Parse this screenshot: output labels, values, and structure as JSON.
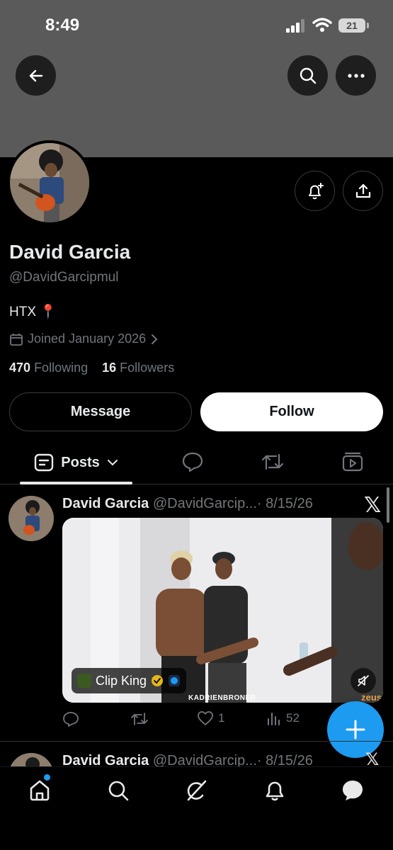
{
  "status_bar": {
    "time": "8:49",
    "battery": "21"
  },
  "profile": {
    "name": "David Garcia",
    "handle": "@DavidGarcipmul",
    "bio": "HTX 📍",
    "joined": "Joined January 2026",
    "following_count": "470",
    "following_label": "Following",
    "followers_count": "16",
    "followers_label": "Followers"
  },
  "buttons": {
    "message": "Message",
    "follow": "Follow"
  },
  "tabs": {
    "posts": "Posts"
  },
  "posts": [
    {
      "name": "David Garcia",
      "handle": "@DavidGarcip...",
      "date": "· 8/15/26",
      "media_badge": "Clip King",
      "watermark": "KADRIENBRONER",
      "brand": "zeus",
      "likes": "1",
      "views": "52"
    },
    {
      "name": "David Garcia",
      "handle": "@DavidGarcip...",
      "date": "· 8/15/26"
    }
  ],
  "colors": {
    "accent": "#1d9bf0",
    "banner": "#5a5a5a",
    "muted": "#71767b"
  }
}
